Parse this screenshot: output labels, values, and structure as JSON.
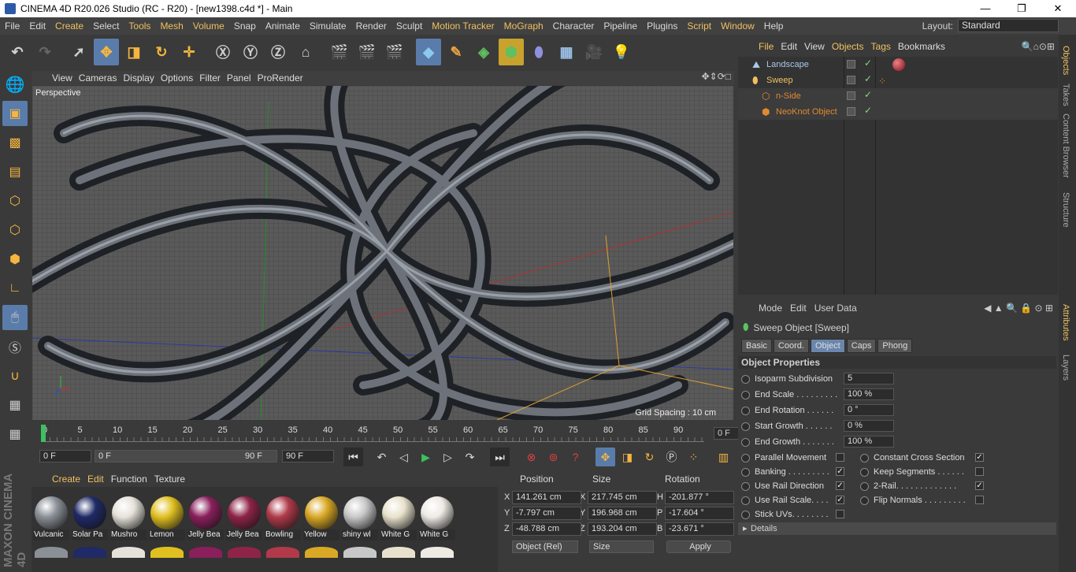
{
  "window": {
    "title": "CINEMA 4D R20.026 Studio (RC - R20) - [new1398.c4d *] - Main",
    "minimize": "—",
    "maximize": "❐",
    "close": "✕"
  },
  "menu": [
    "File",
    "Edit",
    "Create",
    "Select",
    "Tools",
    "Mesh",
    "Volume",
    "Snap",
    "Animate",
    "Simulate",
    "Render",
    "Sculpt",
    "Motion Tracker",
    "MoGraph",
    "Character",
    "Pipeline",
    "Plugins",
    "Script",
    "Window",
    "Help"
  ],
  "menu_highlight": [
    "Create",
    "Tools",
    "Mesh",
    "Volume",
    "Motion Tracker",
    "MoGraph",
    "Script",
    "Window"
  ],
  "layout": {
    "label": "Layout:",
    "value": "Standard"
  },
  "viewport": {
    "menu": [
      "View",
      "Cameras",
      "Display",
      "Options",
      "Filter",
      "Panel",
      "ProRender"
    ],
    "label": "Perspective",
    "grid": "Grid Spacing : 10 cm"
  },
  "timeline": {
    "ticks": [
      "0",
      "5",
      "10",
      "15",
      "20",
      "25",
      "30",
      "35",
      "40",
      "45",
      "50",
      "55",
      "60",
      "65",
      "70",
      "75",
      "80",
      "85",
      "90"
    ],
    "current": "0 F",
    "start": "0 F",
    "range_start": "0 F",
    "range_end": "90 F",
    "end": "90 F"
  },
  "materials": {
    "menu": [
      "Create",
      "Edit",
      "Function",
      "Texture"
    ],
    "items": [
      {
        "name": "Vulcanic",
        "color": "#8a9096"
      },
      {
        "name": "Solar Pa",
        "color": "#1f2a66"
      },
      {
        "name": "Mushro",
        "color": "#e6e2da"
      },
      {
        "name": "Lemon",
        "color": "#e0c020"
      },
      {
        "name": "Jelly Bea",
        "color": "#8a1f5c"
      },
      {
        "name": "Jelly Bea",
        "color": "#8e2448"
      },
      {
        "name": "Bowling",
        "color": "#b03a4a"
      },
      {
        "name": "Yellow",
        "color": "#d9a825"
      },
      {
        "name": "shiny wl",
        "color": "#c8c8c8"
      },
      {
        "name": "White G",
        "color": "#e8e2cc"
      },
      {
        "name": "White G",
        "color": "#eeeae4"
      }
    ]
  },
  "coords": {
    "headers": [
      "Position",
      "Size",
      "Rotation"
    ],
    "rows": [
      {
        "axis": "X",
        "pos": "141.261 cm",
        "saxis": "X",
        "size": "217.745 cm",
        "raxis": "H",
        "rot": "-201.877 °"
      },
      {
        "axis": "Y",
        "pos": "-7.797 cm",
        "saxis": "Y",
        "size": "196.968 cm",
        "raxis": "P",
        "rot": "-17.604 °"
      },
      {
        "axis": "Z",
        "pos": "-48.788 cm",
        "saxis": "Z",
        "size": "193.204 cm",
        "raxis": "B",
        "rot": "-23.671 °"
      }
    ],
    "mode": "Object (Rel)",
    "sizemode": "Size",
    "apply": "Apply"
  },
  "objects": {
    "tabs": [
      "File",
      "Edit",
      "View",
      "Objects",
      "Tags",
      "Bookmarks"
    ],
    "tabs_highlight": [
      "File",
      "Objects",
      "Tags"
    ],
    "items": [
      {
        "name": "Landscape",
        "color": "#a8c8e8",
        "indent": 0
      },
      {
        "name": "Sweep",
        "color": "#f0c060",
        "indent": 0
      },
      {
        "name": "n-Side",
        "color": "#e08a30",
        "indent": 1
      },
      {
        "name": "NeoKnot Object",
        "color": "#e08a30",
        "indent": 1
      }
    ]
  },
  "attributes": {
    "menu": [
      "Mode",
      "Edit",
      "User Data"
    ],
    "title": "Sweep Object [Sweep]",
    "tabs": [
      "Basic",
      "Coord.",
      "Object",
      "Caps",
      "Phong"
    ],
    "active_tab": "Object",
    "section": "Object Properties",
    "fields": [
      {
        "label": "Isoparm Subdivision",
        "value": "5"
      },
      {
        "label": "End Scale . . . . . . . . .",
        "value": "100 %"
      },
      {
        "label": "End Rotation . . . . . .",
        "value": "0 °"
      },
      {
        "label": "Start Growth . . . . . .",
        "value": "0 %"
      },
      {
        "label": "End Growth . . . . . . .",
        "value": "100 %"
      }
    ],
    "left_checks": [
      {
        "label": "Parallel Movement",
        "checked": false
      },
      {
        "label": "Banking . . . . . . . . .",
        "checked": true
      },
      {
        "label": "Use Rail Direction",
        "checked": true
      },
      {
        "label": "Use Rail Scale. . . .",
        "checked": true
      },
      {
        "label": "Stick UVs. . . . . . . .",
        "checked": false
      }
    ],
    "right_checks": [
      {
        "label": "Constant Cross Section",
        "checked": true
      },
      {
        "label": "Keep Segments . . . . . .",
        "checked": false
      },
      {
        "label": "2-Rail. . . . . . . . . . . . .",
        "checked": true
      },
      {
        "label": "Flip Normals . . . . . . . . .",
        "checked": false
      }
    ],
    "details": "Details"
  },
  "side_tabs": [
    "Objects",
    "Takes",
    "Content Browser",
    "Structure"
  ],
  "side_tabs_lower": [
    "Attributes",
    "Layers"
  ],
  "logo": "MAXON CINEMA 4D"
}
